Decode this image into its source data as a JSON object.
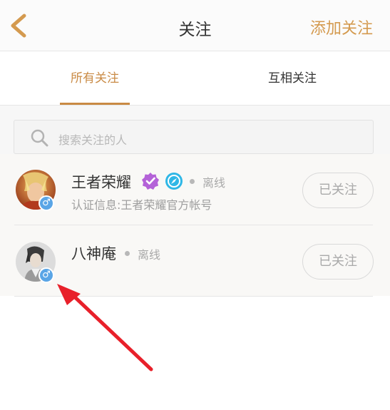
{
  "header": {
    "back_icon": "chevron-left-icon",
    "title": "关注",
    "add_follow_label": "添加关注",
    "accent_color": "#d49a4f"
  },
  "tabs": [
    {
      "label": "所有关注",
      "active": true
    },
    {
      "label": "互相关注",
      "active": false
    }
  ],
  "search": {
    "placeholder": "搜索关注的人",
    "icon": "search-icon"
  },
  "follows": [
    {
      "name": "王者荣耀",
      "verified_icon": "verified-badge-icon",
      "extra_icon": "compass-icon",
      "status": "离线",
      "certification": "认证信息:王者荣耀官方帐号",
      "gender_icon": "male-icon",
      "button_label": "已关注"
    },
    {
      "name": "八神庵",
      "status": "离线",
      "gender_icon": "male-icon",
      "button_label": "已关注"
    }
  ],
  "annotation": {
    "arrow_color": "#e8202a"
  }
}
